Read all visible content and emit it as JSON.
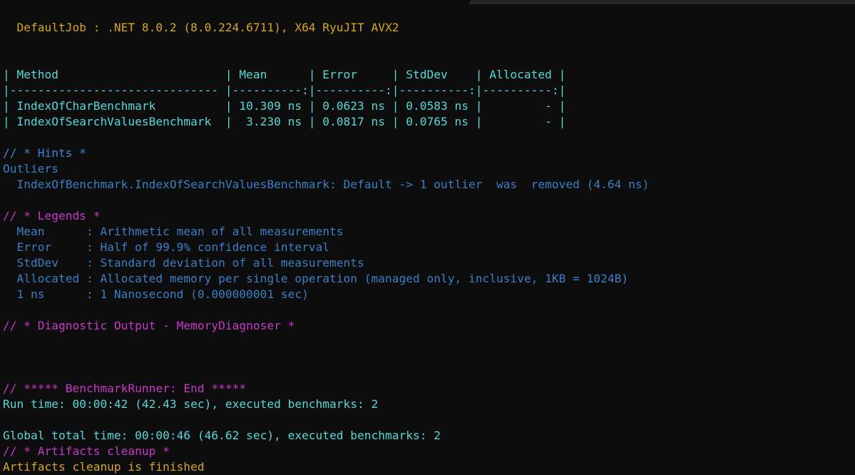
{
  "window": {
    "chrome_strip_color": "#262626",
    "background_color": "#0d0d0d"
  },
  "palette": {
    "yellow": "#d7a520",
    "cyan": "#56d8d8",
    "blue": "#3a7fc4",
    "magenta": "#c838c8",
    "white": "#d6d6d6"
  },
  "terminal": {
    "job_line": "  DefaultJob : .NET 8.0.2 (8.0.224.6711), X64 RyuJIT AVX2",
    "table": {
      "header_row": "| Method                        | Mean      | Error     | StdDev    | Allocated |",
      "separator_row": "|------------------------------ |----------:|----------:|----------:|----------:|",
      "columns": [
        "Method",
        "Mean",
        "Error",
        "StdDev",
        "Allocated"
      ],
      "rows": [
        {
          "raw": "| IndexOfCharBenchmark          | 10.309 ns | 0.0623 ns | 0.0583 ns |         - |",
          "method": "IndexOfCharBenchmark",
          "mean": "10.309 ns",
          "error": "0.0623 ns",
          "stddev": "0.0583 ns",
          "allocated": "-"
        },
        {
          "raw": "| IndexOfSearchValuesBenchmark  |  3.230 ns | 0.0817 ns | 0.0765 ns |         - |",
          "method": "IndexOfSearchValuesBenchmark",
          "mean": "3.230 ns",
          "error": "0.0817 ns",
          "stddev": "0.0765 ns",
          "allocated": "-"
        }
      ]
    },
    "hints": {
      "heading": "// * Hints *",
      "subheading": "Outliers",
      "detail": "  IndexOfBenchmark.IndexOfSearchValuesBenchmark: Default -> 1 outlier  was  removed (4.64 ns)"
    },
    "legends": {
      "heading": "// * Legends *",
      "entries": [
        "  Mean      : Arithmetic mean of all measurements",
        "  Error     : Half of 99.9% confidence interval",
        "  StdDev    : Standard deviation of all measurements",
        "  Allocated : Allocated memory per single operation (managed only, inclusive, 1KB = 1024B)",
        "  1 ns      : 1 Nanosecond (0.000000001 sec)"
      ]
    },
    "diagnostic": {
      "heading": "// * Diagnostic Output - MemoryDiagnoser *"
    },
    "runner_end": {
      "heading": "// ***** BenchmarkRunner: End *****",
      "run_time": "Run time: 00:00:42 (42.43 sec), executed benchmarks: 2",
      "global_total_time": "Global total time: 00:00:46 (46.62 sec), executed benchmarks: 2"
    },
    "artifacts": {
      "heading": "// * Artifacts cleanup *",
      "status": "Artifacts cleanup is finished"
    }
  }
}
